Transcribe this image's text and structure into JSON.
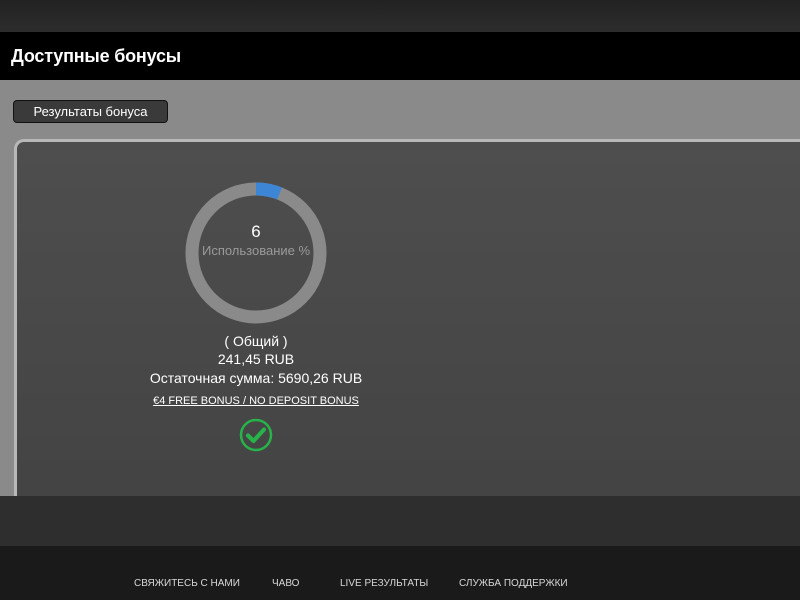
{
  "header": {
    "title": "Доступные бонусы"
  },
  "toolbar": {
    "results_button_label": "Результаты бонуса"
  },
  "bonus": {
    "usage_value": "6",
    "usage_caption": "Использование %",
    "usage_percent": 6,
    "type_label": "( Общий )",
    "amount": "241,45 RUB",
    "remaining": "Остаточная сумма: 5690,26 RUB",
    "name": "€4 FREE BONUS / NO DEPOSIT BONUS",
    "status_icon": "check-circle-icon",
    "colors": {
      "progress": "#3d86d6",
      "track": "#8a8a8a",
      "status": "#27b34a"
    }
  },
  "footer": {
    "links": [
      {
        "label": "СВЯЖИТЕСЬ С НАМИ"
      },
      {
        "label": "ЧАВО"
      },
      {
        "label": "LIVE РЕЗУЛЬТАТЫ"
      },
      {
        "label": "СЛУЖБА ПОДДЕРЖКИ"
      }
    ]
  }
}
